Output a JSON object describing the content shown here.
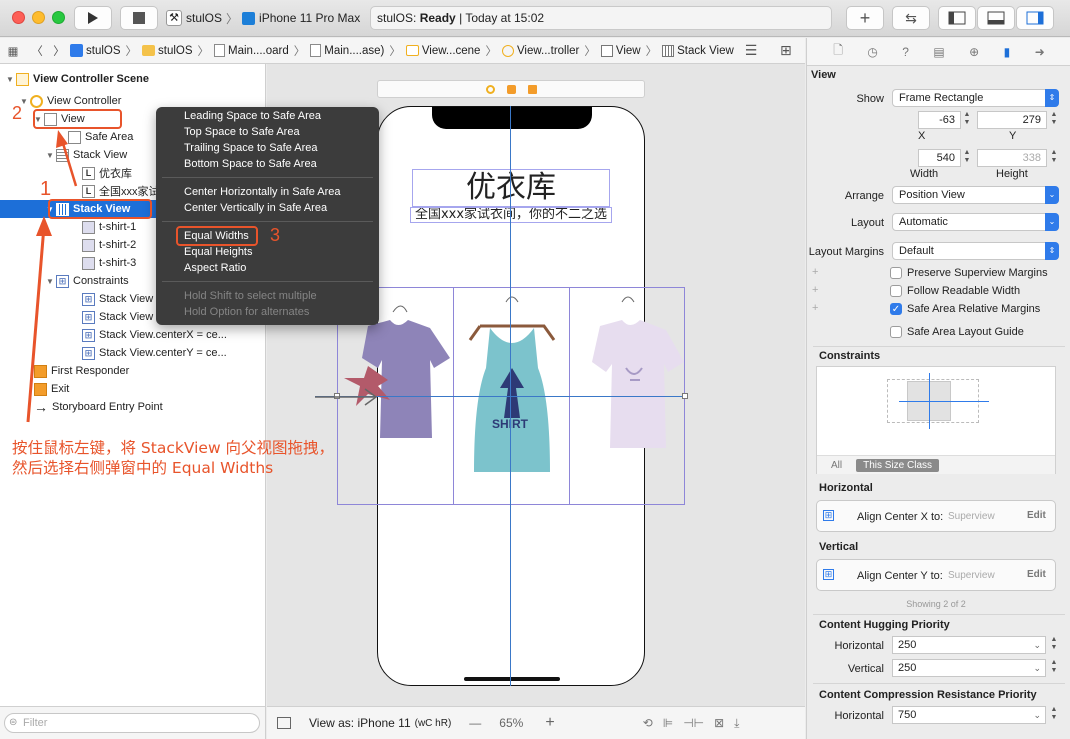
{
  "titlebar": {
    "scheme_app": "stulOS",
    "scheme_device": "iPhone 11 Pro Max",
    "status_app": "stulOS:",
    "status_state": "Ready",
    "status_time": "| Today at 15:02"
  },
  "jumpbar": {
    "crumbs": [
      "stulOS",
      "stulOS",
      "Main....oard",
      "Main....ase)",
      "View...cene",
      "View...troller",
      "View",
      "Stack View"
    ]
  },
  "outline": {
    "rows": [
      "View Controller Scene",
      "View Controller",
      "View",
      "Safe Area",
      "Stack View",
      "优衣库",
      "全国xxx家试",
      "Stack View",
      "t-shirt-1",
      "t-shirt-2",
      "t-shirt-3",
      "Constraints",
      "Stack View",
      "Stack View",
      "Stack View.centerX = ce...",
      "Stack View.centerY = ce...",
      "First Responder",
      "Exit",
      "Storyboard Entry Point"
    ],
    "filter_placeholder": "Filter"
  },
  "popup": {
    "group1": [
      "Leading Space to Safe Area",
      "Top Space to Safe Area",
      "Trailing Space to Safe Area",
      "Bottom Space to Safe Area"
    ],
    "group2": [
      "Center Horizontally in Safe Area",
      "Center Vertically in Safe Area"
    ],
    "group3": [
      "Equal Widths",
      "Equal Heights",
      "Aspect Ratio"
    ],
    "hints": [
      "Hold Shift to select multiple",
      "Hold Option for alternates"
    ]
  },
  "annotations": {
    "n1": "1",
    "n2": "2",
    "n3": "3",
    "line1": "按住鼠标左键，将 StackView 向父视图拖拽，",
    "line2": "然后选择右侧弹窗中的 Equal Widths"
  },
  "canvas": {
    "title_label": "优衣库",
    "sub_label": "全国xxx家试衣间，你的不二之选",
    "view_as": "View as: iPhone 11",
    "size_class": "(wC hR)",
    "zoom": "65%"
  },
  "inspector": {
    "header": "View",
    "show_label": "Show",
    "show_value": "Frame Rectangle",
    "x_value": "-63",
    "y_value": "279",
    "x_label": "X",
    "y_label": "Y",
    "width_value": "540",
    "height_value": "338",
    "width_label": "Width",
    "height_label": "Height",
    "arrange_label": "Arrange",
    "arrange_value": "Position View",
    "layout_label": "Layout",
    "layout_value": "Automatic",
    "margins_label": "Layout Margins",
    "margins_value": "Default",
    "checks": [
      {
        "label": "Preserve Superview Margins",
        "on": false
      },
      {
        "label": "Follow Readable Width",
        "on": false
      },
      {
        "label": "Safe Area Relative Margins",
        "on": true
      },
      {
        "label": "Safe Area Layout Guide",
        "on": false
      }
    ],
    "constraints_header": "Constraints",
    "seg_all": "All",
    "seg_size_class": "This Size Class",
    "horizontal_header": "Horizontal",
    "h_constraint": "Align Center X to:",
    "h_target": "Superview",
    "vertical_header": "Vertical",
    "v_constraint": "Align Center Y to:",
    "v_target": "Superview",
    "edit": "Edit",
    "showing": "Showing 2 of 2",
    "hugging_header": "Content Hugging Priority",
    "hug_h_label": "Horizontal",
    "hug_h_value": "250",
    "hug_v_label": "Vertical",
    "hug_v_value": "250",
    "compression_header": "Content Compression Resistance Priority",
    "comp_h_label": "Horizontal",
    "comp_h_value": "750"
  },
  "colors": {
    "accent": "#2f7bea",
    "selection": "#1d6fd8",
    "annotation": "#e8542b",
    "guide": "#3a78c8",
    "stack_border": "#8e86d8"
  }
}
